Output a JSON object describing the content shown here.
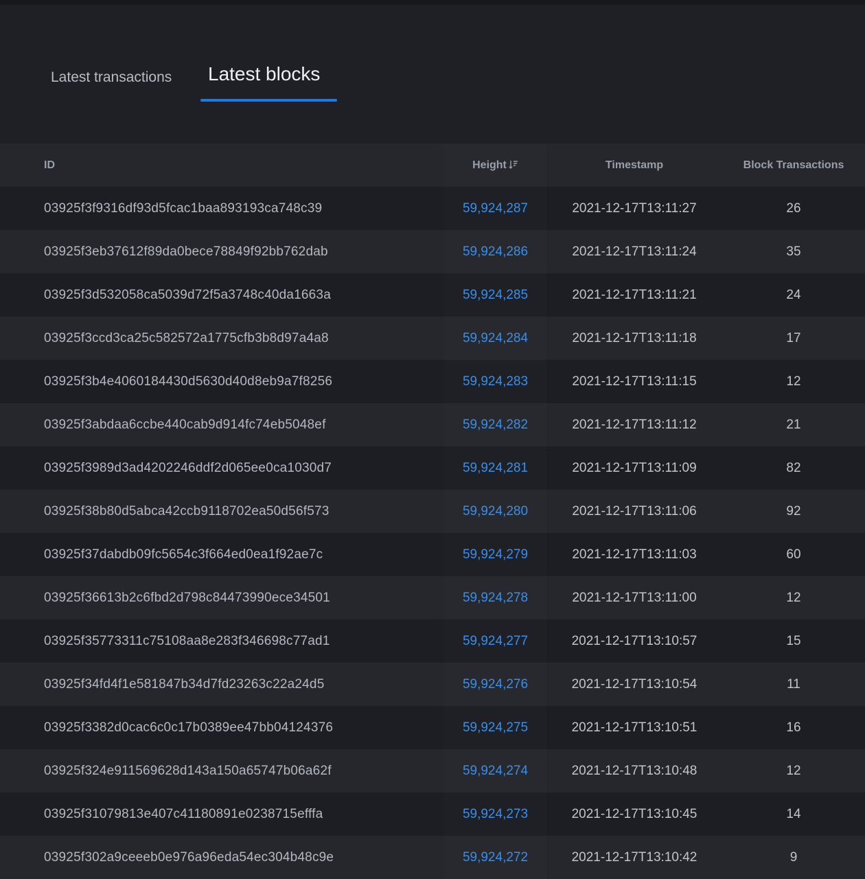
{
  "tabs": [
    {
      "label": "Latest transactions",
      "active": false
    },
    {
      "label": "Latest blocks",
      "active": true
    }
  ],
  "table": {
    "headers": {
      "id": "ID",
      "height": "Height",
      "timestamp": "Timestamp",
      "block_transactions": "Block Transactions"
    },
    "sort_icon": "sort-descending-icon",
    "rows": [
      {
        "id": "03925f3f9316df93d5fcac1baa893193ca748c39",
        "height": "59,924,287",
        "timestamp": "2021-12-17T13:11:27",
        "block_transactions": "26"
      },
      {
        "id": "03925f3eb37612f89da0bece78849f92bb762dab",
        "height": "59,924,286",
        "timestamp": "2021-12-17T13:11:24",
        "block_transactions": "35"
      },
      {
        "id": "03925f3d532058ca5039d72f5a3748c40da1663a",
        "height": "59,924,285",
        "timestamp": "2021-12-17T13:11:21",
        "block_transactions": "24"
      },
      {
        "id": "03925f3ccd3ca25c582572a1775cfb3b8d97a4a8",
        "height": "59,924,284",
        "timestamp": "2021-12-17T13:11:18",
        "block_transactions": "17"
      },
      {
        "id": "03925f3b4e4060184430d5630d40d8eb9a7f8256",
        "height": "59,924,283",
        "timestamp": "2021-12-17T13:11:15",
        "block_transactions": "12"
      },
      {
        "id": "03925f3abdaa6ccbe440cab9d914fc74eb5048ef",
        "height": "59,924,282",
        "timestamp": "2021-12-17T13:11:12",
        "block_transactions": "21"
      },
      {
        "id": "03925f3989d3ad4202246ddf2d065ee0ca1030d7",
        "height": "59,924,281",
        "timestamp": "2021-12-17T13:11:09",
        "block_transactions": "82"
      },
      {
        "id": "03925f38b80d5abca42ccb9118702ea50d56f573",
        "height": "59,924,280",
        "timestamp": "2021-12-17T13:11:06",
        "block_transactions": "92"
      },
      {
        "id": "03925f37dabdb09fc5654c3f664ed0ea1f92ae7c",
        "height": "59,924,279",
        "timestamp": "2021-12-17T13:11:03",
        "block_transactions": "60"
      },
      {
        "id": "03925f36613b2c6fbd2d798c84473990ece34501",
        "height": "59,924,278",
        "timestamp": "2021-12-17T13:11:00",
        "block_transactions": "12"
      },
      {
        "id": "03925f35773311c75108aa8e283f346698c77ad1",
        "height": "59,924,277",
        "timestamp": "2021-12-17T13:10:57",
        "block_transactions": "15"
      },
      {
        "id": "03925f34fd4f1e581847b34d7fd23263c22a24d5",
        "height": "59,924,276",
        "timestamp": "2021-12-17T13:10:54",
        "block_transactions": "11"
      },
      {
        "id": "03925f3382d0cac6c0c17b0389ee47bb04124376",
        "height": "59,924,275",
        "timestamp": "2021-12-17T13:10:51",
        "block_transactions": "16"
      },
      {
        "id": "03925f324e911569628d143a150a65747b06a62f",
        "height": "59,924,274",
        "timestamp": "2021-12-17T13:10:48",
        "block_transactions": "12"
      },
      {
        "id": "03925f31079813e407c41180891e0238715efffa",
        "height": "59,924,273",
        "timestamp": "2021-12-17T13:10:45",
        "block_transactions": "14"
      },
      {
        "id": "03925f302a9ceeeb0e976a96eda54ec304b48c9e",
        "height": "59,924,272",
        "timestamp": "2021-12-17T13:10:42",
        "block_transactions": "9"
      }
    ]
  },
  "colors": {
    "background": "#1e2026",
    "accent": "#1f7ae0",
    "link": "#3a8ee8"
  }
}
